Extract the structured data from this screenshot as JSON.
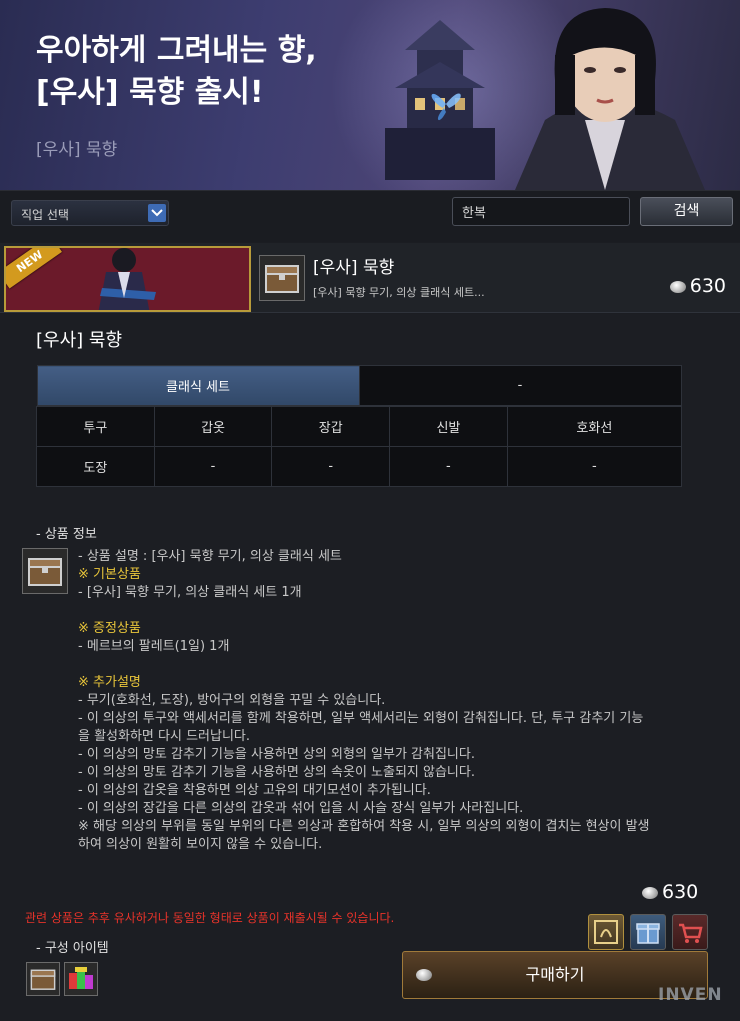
{
  "banner": {
    "title_line1": "우아하게 그려내는 향,",
    "title_line2": "[우사] 묵향 출시!",
    "subtitle": "[우사] 묵향"
  },
  "filter": {
    "job_select_label": "직업 선택",
    "search_value": "한복",
    "search_button": "검색"
  },
  "product": {
    "badge": "NEW",
    "name": "[우사] 묵향",
    "desc": "[우사] 묵향 무기, 의상 클래식 세트...",
    "price": "630"
  },
  "detail": {
    "title": "[우사] 묵향",
    "tabs": [
      "클래식 세트",
      "-"
    ],
    "table_headers": [
      "투구",
      "갑옷",
      "장갑",
      "신발",
      "호화선"
    ],
    "table_row": [
      "도장",
      "-",
      "-",
      "-",
      "-"
    ]
  },
  "info": {
    "header": "- 상품 정보",
    "lines": [
      {
        "text": "- 상품 설명 : [우사] 묵향 무기, 의상 클래식 세트",
        "hl": false
      },
      {
        "text": "※ 기본상품",
        "hl": true
      },
      {
        "text": "- [우사] 묵향 무기, 의상 클래식 세트 1개",
        "hl": false
      },
      {
        "text": "",
        "hl": false
      },
      {
        "text": "※ 증정상품",
        "hl": true
      },
      {
        "text": "- 메르브의 팔레트(1일) 1개",
        "hl": false
      },
      {
        "text": "",
        "hl": false
      },
      {
        "text": "※ 추가설명",
        "hl": true
      },
      {
        "text": "- 무기(호화선, 도장), 방어구의 외형을 꾸밀 수 있습니다.",
        "hl": false
      },
      {
        "text": "- 이 의상의 투구와 액세서리를 함께 착용하면, 일부 액세서리는 외형이 감춰집니다. 단, 투구 감추기 기능",
        "hl": false
      },
      {
        "text": "을 활성화하면 다시 드러납니다.",
        "hl": false
      },
      {
        "text": "- 이 의상의 망토 감추기 기능을 사용하면 상의 외형의 일부가 감춰집니다.",
        "hl": false
      },
      {
        "text": "- 이 의상의 망토 감추기 기능을 사용하면 상의 속옷이 노출되지 않습니다.",
        "hl": false
      },
      {
        "text": "- 이 의상의 갑옷을 착용하면 의상 고유의 대기모션이 추가됩니다.",
        "hl": false
      },
      {
        "text": "- 이 의상의 장갑을 다른 의상의 갑옷과 섞어 입을 시 사슬 장식 일부가 사라집니다.",
        "hl": false
      },
      {
        "text": "※ 해당 의상의 부위를 동일 부위의 다른 의상과 혼합하여 착용 시, 일부 의상의 외형이 겹치는 현상이 발생",
        "hl": false
      },
      {
        "text": "하여 의상이 원활히 보이지 않을 수 있습니다.",
        "hl": false
      }
    ]
  },
  "purchase": {
    "price": "630",
    "notice": "관련 상품은 추후 유사하거나 동일한 형태로 상품이 재출시될 수 있습니다.",
    "components_header": "- 구성 아이템",
    "buy_label": "구매하기"
  },
  "watermark": "INVEN",
  "colors": {
    "accent_blue": "#3e6bb5",
    "highlight_yellow": "#e8c53a",
    "notice_red": "#e8332a",
    "new_badge": "#d39a1e"
  },
  "icons": [
    "chevron-down-icon",
    "chest-icon",
    "silver-coin-icon",
    "wardrobe-icon",
    "gift-icon",
    "cart-icon",
    "palette-icon"
  ]
}
